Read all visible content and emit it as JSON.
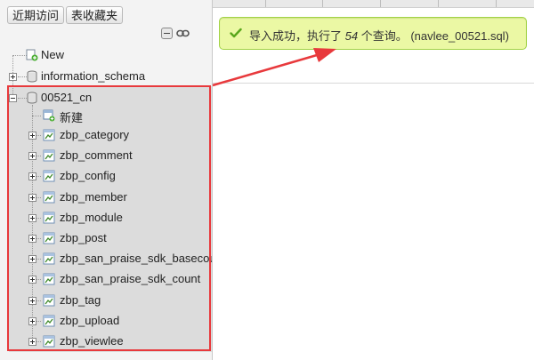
{
  "nav": {
    "recent_label": "近期访问",
    "favorites_label": "表收藏夹",
    "tree": {
      "new_label": "New",
      "info_schema_label": "information_schema",
      "current_db": {
        "name": "00521_cn",
        "new_table_label": "新建",
        "tables": [
          "zbp_category",
          "zbp_comment",
          "zbp_config",
          "zbp_member",
          "zbp_module",
          "zbp_post",
          "zbp_san_praise_sdk_basecou",
          "zbp_san_praise_sdk_count",
          "zbp_tag",
          "zbp_upload",
          "zbp_viewlee"
        ]
      }
    }
  },
  "message": {
    "prefix": "导入成功，执行了 ",
    "count": "54",
    "suffix": " 个查询。 (navlee_00521.sql)"
  },
  "colors": {
    "highlight": "#e8393c",
    "success_bg": "#ebf8a4",
    "success_border": "#a2d246",
    "check": "#58a61b"
  }
}
